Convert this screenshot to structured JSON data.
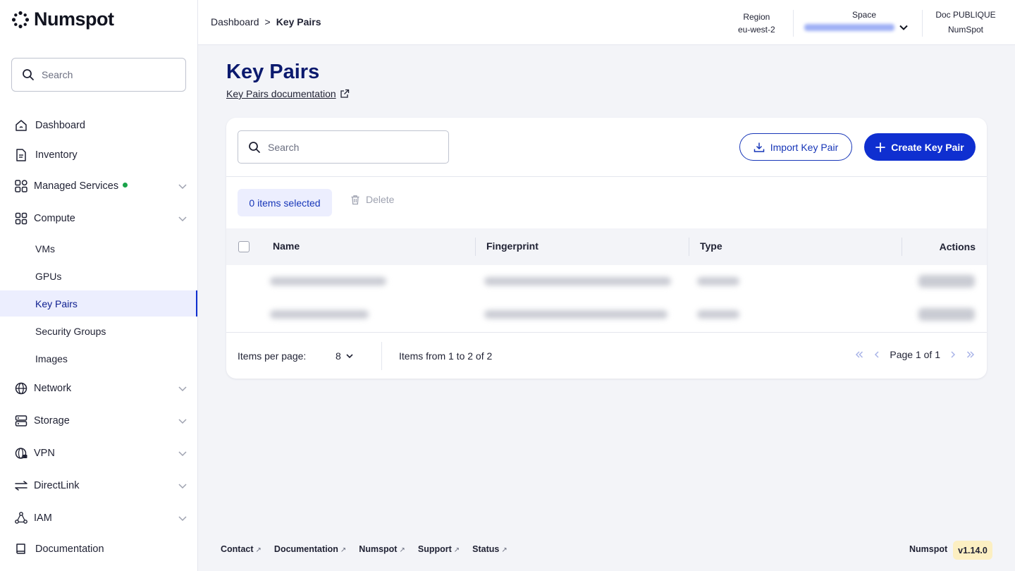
{
  "brand": {
    "name": "Numspot"
  },
  "sidebar": {
    "search_placeholder": "Search",
    "items": [
      {
        "label": "Dashboard"
      },
      {
        "label": "Inventory"
      },
      {
        "label": "Managed Services"
      },
      {
        "label": "Compute"
      },
      {
        "label": "Network"
      },
      {
        "label": "Storage"
      },
      {
        "label": "VPN"
      },
      {
        "label": "DirectLink"
      },
      {
        "label": "IAM"
      },
      {
        "label": "Documentation"
      }
    ],
    "compute_children": [
      {
        "label": "VMs"
      },
      {
        "label": "GPUs"
      },
      {
        "label": "Key Pairs",
        "active": true
      },
      {
        "label": "Security Groups"
      },
      {
        "label": "Images"
      }
    ]
  },
  "header": {
    "breadcrumb": {
      "root": "Dashboard",
      "separator": ">",
      "current": "Key Pairs"
    },
    "region": {
      "label": "Region",
      "value": "eu-west-2"
    },
    "space": {
      "label": "Space"
    },
    "org": {
      "label": "Doc PUBLIQUE",
      "value": "NumSpot"
    }
  },
  "page": {
    "title": "Key Pairs",
    "doc_link": "Key Pairs documentation"
  },
  "table": {
    "search_placeholder": "Search",
    "import_label": "Import Key Pair",
    "create_label": "Create Key Pair",
    "selected_label": "0 items selected",
    "delete_label": "Delete",
    "columns": {
      "name": "Name",
      "fingerprint": "Fingerprint",
      "type": "Type",
      "actions": "Actions"
    },
    "pagination": {
      "per_page_label": "Items per page:",
      "per_page_value": "8",
      "range_text": "Items from 1 to 2 of 2",
      "page_text": "Page 1 of 1"
    }
  },
  "footer": {
    "links": [
      {
        "label": "Contact"
      },
      {
        "label": "Documentation"
      },
      {
        "label": "Numspot"
      },
      {
        "label": "Support"
      },
      {
        "label": "Status"
      }
    ],
    "brand": "Numspot",
    "version": "v1.14.0"
  },
  "colors": {
    "primary": "#0f2fd0",
    "title": "#0b1a6e",
    "status_green": "#1aa34a",
    "version_bg": "#fcefc2"
  }
}
